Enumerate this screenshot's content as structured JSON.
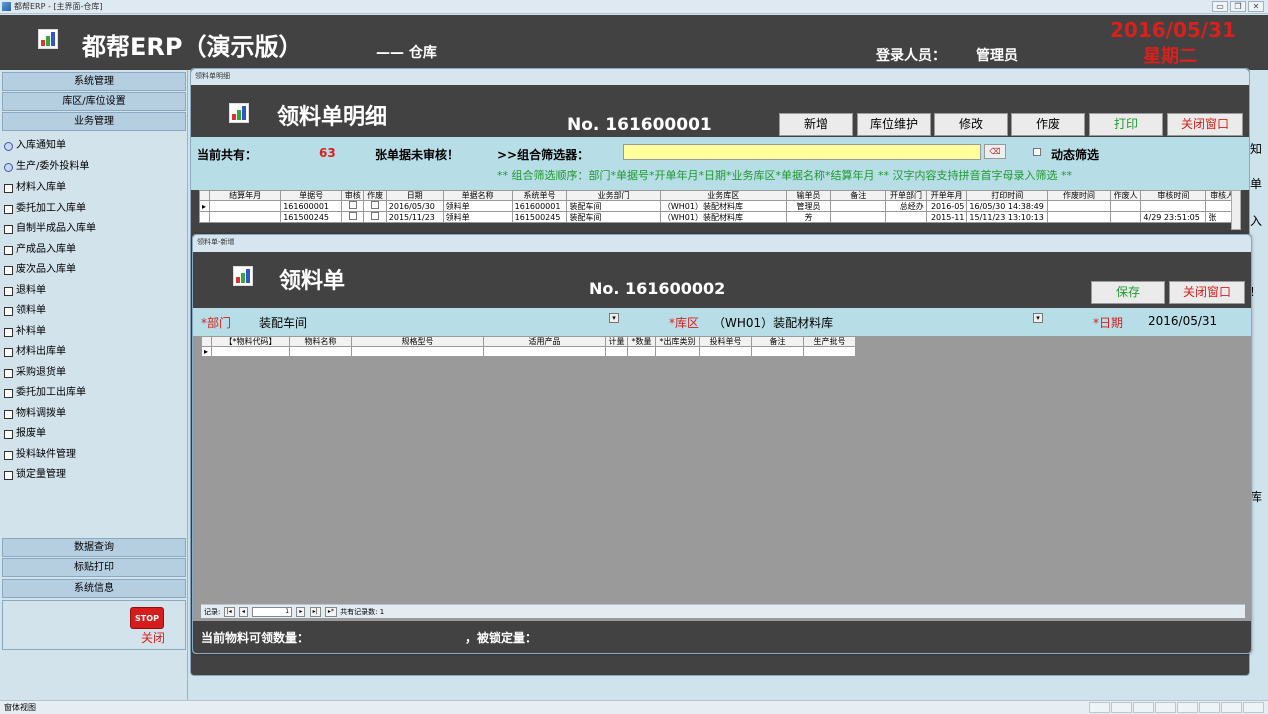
{
  "window": {
    "caption": "都帮ERP - [主界面-仓库]"
  },
  "header": {
    "title": "都帮ERP（演示版）",
    "subtitle": "—— 仓库",
    "login_label": "登录人员：",
    "user": "管理员",
    "date": "2016/05/31",
    "weekday": "星期二"
  },
  "sidebar": {
    "sections_top": [
      "系统管理",
      "库区/库位设置",
      "业务管理"
    ],
    "items": [
      "入库通知单",
      "生产/委外投料单",
      "材料入库单",
      "委托加工入库单",
      "自制半成品入库单",
      "产成品入库单",
      "废次品入库单",
      "退料单",
      "领料单",
      "补料单",
      "材料出库单",
      "采购退货单",
      "委托加工出库单",
      "物料调拨单",
      "报废单",
      "投料缺件管理",
      "锁定量管理"
    ],
    "sections_bottom": [
      "数据查询",
      "标贴打印",
      "系统信息"
    ],
    "stop_icon_text": "STOP",
    "close_label": "关闭"
  },
  "right_edge": [
    "知",
    "单",
    "入",
    "!",
    "库"
  ],
  "detail_window": {
    "caption": "领料单明细",
    "title": "领料单明细",
    "number": "No. 161600001",
    "buttons": {
      "new": "新增",
      "location": "库位维护",
      "edit": "修改",
      "void": "作废",
      "print": "打印",
      "close": "关闭窗口"
    },
    "count_label": "当前共有：",
    "count": "63",
    "unreviewed": "张单据未审核！",
    "filter_label": ">>组合筛选器：",
    "filter_value": "",
    "dynamic_filter": "动态筛选",
    "hint": "** 组合筛选顺序：部门*单据号*开单年月*日期*业务库区*单据名称*结算年月 ** 汉字内容支持拼音首字母录入筛选 **",
    "columns": [
      "结算年月",
      "单据号",
      "审核",
      "作废",
      "日期",
      "单据名称",
      "系统单号",
      "业务部门",
      "业务库区",
      "输单员",
      "备注",
      "开单部门",
      "开单年月",
      "打印时间",
      "作废时间",
      "作废人",
      "审核时间",
      "审核人"
    ],
    "rows": [
      [
        "",
        "161600001",
        "",
        "",
        "2016/05/30",
        "领料单",
        "161600001",
        "装配车间",
        "（WH01）装配材料库",
        "管理员",
        "",
        "总经办",
        "2016-05",
        "16/05/30 14:38:49",
        "",
        "",
        "",
        ""
      ],
      [
        "",
        "161500245",
        "",
        "",
        "2015/11/23",
        "领料单",
        "161500245",
        "装配车间",
        "（WH01）装配材料库",
        "芳",
        "",
        "",
        "2015-11",
        "15/11/23 13:10:13",
        "",
        "",
        "4/29 23:51:05",
        "张"
      ]
    ]
  },
  "new_window": {
    "caption": "领料单-新增",
    "title": "领料单",
    "number": "No. 161600002",
    "buttons": {
      "save": "保存",
      "close": "关闭窗口"
    },
    "dept_label": "*部门",
    "dept_value": "装配车间",
    "warehouse_label": "*库区",
    "warehouse_value": "（WH01）装配材料库",
    "date_label": "*日期",
    "date_value": "2016/05/31",
    "columns": [
      "【*物料代码】",
      "物料名称",
      "规格型号",
      "适用产品",
      "计量",
      "*数量",
      "*出库类别",
      "投料单号",
      "备注",
      "生产批号"
    ],
    "nav": {
      "label": "记录:",
      "current": "1",
      "total_text": "共有记录数: 1"
    },
    "footer_available": "当前物料可领数量：",
    "footer_locked": "，被锁定量："
  },
  "statusbar": {
    "text": "窗体视图"
  }
}
